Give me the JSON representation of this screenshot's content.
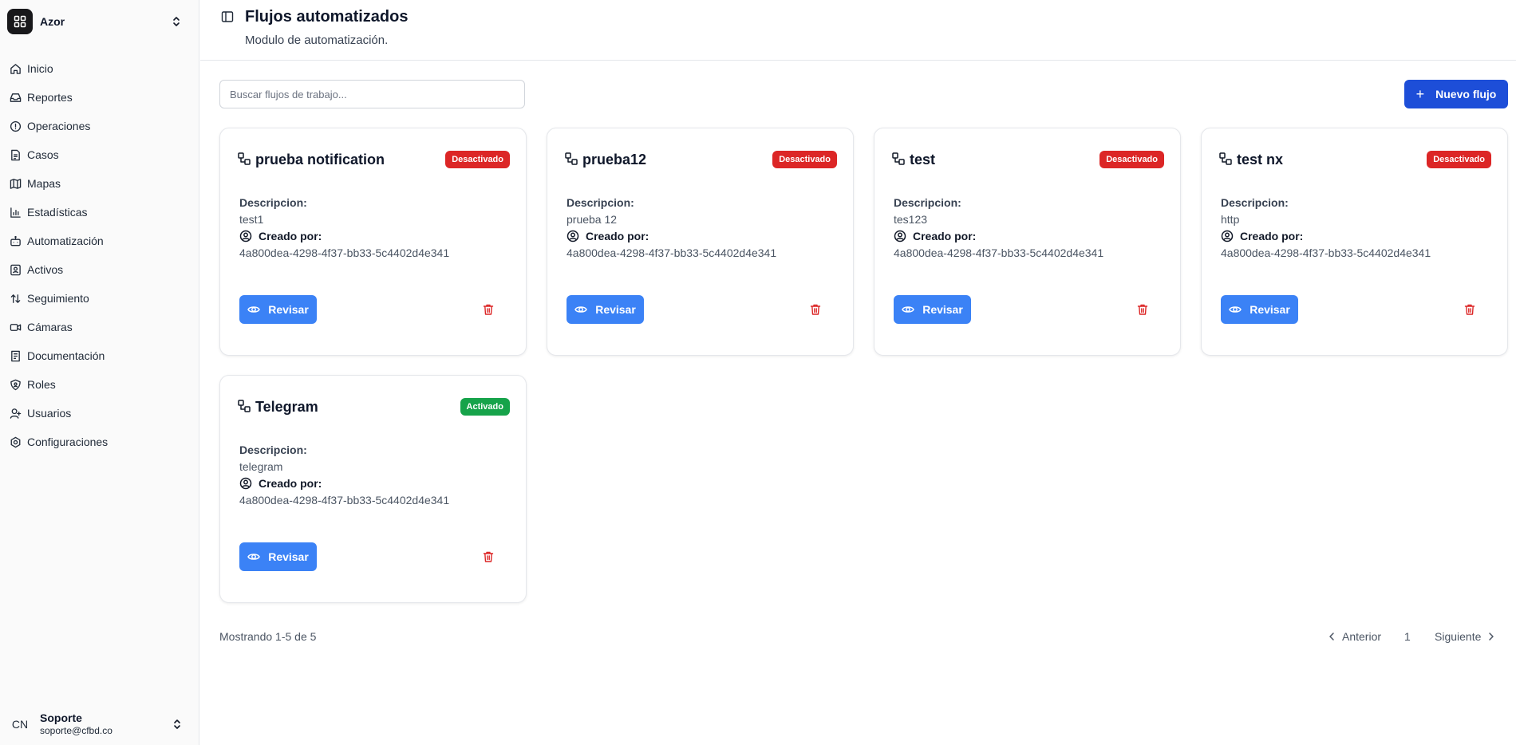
{
  "app": {
    "name": "Azor"
  },
  "sidebar": {
    "items": [
      {
        "label": "Inicio",
        "icon": "home-icon"
      },
      {
        "label": "Reportes",
        "icon": "inbox-icon"
      },
      {
        "label": "Operaciones",
        "icon": "alert-circle-icon"
      },
      {
        "label": "Casos",
        "icon": "file-text-icon"
      },
      {
        "label": "Mapas",
        "icon": "map-icon"
      },
      {
        "label": "Estadísticas",
        "icon": "bar-chart-icon"
      },
      {
        "label": "Automatización",
        "icon": "bot-icon"
      },
      {
        "label": "Activos",
        "icon": "contact-icon"
      },
      {
        "label": "Seguimiento",
        "icon": "arrow-up-down-icon"
      },
      {
        "label": "Cámaras",
        "icon": "video-icon"
      },
      {
        "label": "Documentación",
        "icon": "book-icon"
      },
      {
        "label": "Roles",
        "icon": "shield-icon"
      },
      {
        "label": "Usuarios",
        "icon": "user-icon"
      },
      {
        "label": "Configuraciones",
        "icon": "settings-icon"
      }
    ]
  },
  "user": {
    "initials": "CN",
    "name": "Soporte",
    "email": "soporte@cfbd.co"
  },
  "header": {
    "title": "Flujos automatizados",
    "subtitle": "Modulo de automatización."
  },
  "search": {
    "placeholder": "Buscar flujos de trabajo..."
  },
  "actions": {
    "new_label": "Nuevo flujo"
  },
  "cards": [
    {
      "name": "prueba notification",
      "status": "Desactivado",
      "active": false,
      "desc_label": "Descripcion:",
      "description": "test1",
      "creator_label": "Creado por:",
      "creator_id": "4a800dea-4298-4f37-bb33-5c4402d4e341",
      "review_label": "Revisar"
    },
    {
      "name": "prueba12",
      "status": "Desactivado",
      "active": false,
      "desc_label": "Descripcion:",
      "description": "prueba 12",
      "creator_label": "Creado por:",
      "creator_id": "4a800dea-4298-4f37-bb33-5c4402d4e341",
      "review_label": "Revisar"
    },
    {
      "name": "test",
      "status": "Desactivado",
      "active": false,
      "desc_label": "Descripcion:",
      "description": "tes123",
      "creator_label": "Creado por:",
      "creator_id": "4a800dea-4298-4f37-bb33-5c4402d4e341",
      "review_label": "Revisar"
    },
    {
      "name": "test nx",
      "status": "Desactivado",
      "active": false,
      "desc_label": "Descripcion:",
      "description": "http",
      "creator_label": "Creado por:",
      "creator_id": "4a800dea-4298-4f37-bb33-5c4402d4e341",
      "review_label": "Revisar"
    },
    {
      "name": "Telegram",
      "status": "Activado",
      "active": true,
      "desc_label": "Descripcion:",
      "description": "telegram",
      "creator_label": "Creado por:",
      "creator_id": "4a800dea-4298-4f37-bb33-5c4402d4e341",
      "review_label": "Revisar"
    }
  ],
  "pagination": {
    "showing": "Mostrando 1-5 de 5",
    "prev": "Anterior",
    "page": "1",
    "next": "Siguiente"
  },
  "colors": {
    "primary": "#1d4ed8",
    "review": "#3b82f6",
    "inactive": "#dc2626",
    "active": "#16a34a"
  }
}
